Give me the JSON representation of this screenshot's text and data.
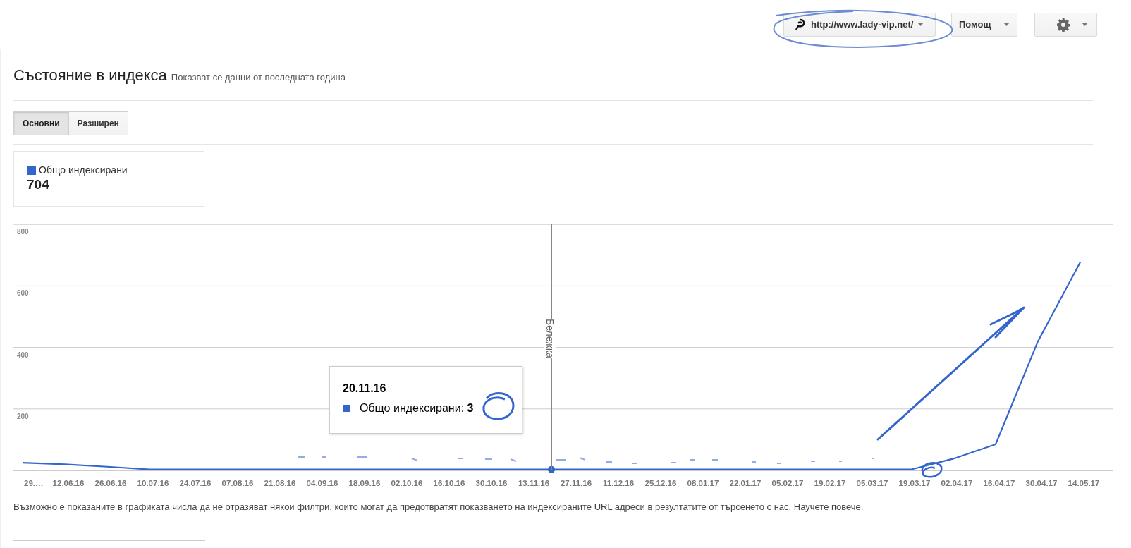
{
  "header": {
    "site_selector": {
      "label": "http://www.lady-vip.net/"
    },
    "help_menu": {
      "label": "Помощ"
    }
  },
  "page": {
    "title": "Състояние в индекса",
    "subtitle": "Показват се данни от последната година"
  },
  "tabs": [
    {
      "label": "Основни",
      "selected": true
    },
    {
      "label": "Разширен",
      "selected": false
    }
  ],
  "legend": {
    "label": "Общо индексирани",
    "value": "704"
  },
  "chart": {
    "chart_data": {
      "type": "line",
      "categories": [
        "29.…",
        "12.06.16",
        "26.06.16",
        "10.07.16",
        "24.07.16",
        "07.08.16",
        "21.08.16",
        "04.09.16",
        "18.09.16",
        "02.10.16",
        "16.10.16",
        "30.10.16",
        "13.11.16",
        "27.11.16",
        "11.12.16",
        "25.12.16",
        "08.01.17",
        "22.01.17",
        "05.02.17",
        "19.02.17",
        "05.03.17",
        "19.03.17",
        "02.04.17",
        "16.04.17",
        "30.04.17",
        "14.05.17"
      ],
      "series": [
        {
          "color": "#3366cc",
          "values": [
            25,
            20,
            12,
            3,
            3,
            3,
            3,
            3,
            3,
            3,
            3,
            3,
            3,
            3,
            3,
            3,
            3,
            3,
            3,
            3,
            3,
            3,
            38,
            85,
            420,
            677
          ]
        }
      ],
      "ylim": [
        0,
        800
      ],
      "yticks": [
        200,
        400,
        600,
        800
      ],
      "grid": true
    },
    "note": {
      "label": "Бележка"
    },
    "tooltip": {
      "date": "20.11.16",
      "text": "Общо индексирани: **3**"
    }
  },
  "footnote": "Възможно е показаните в графиката числа да не отразяват някои филтри, които могат да предотвратят показването на индексираните URL адреси в резултатите от търсенето с нас. Научете повече."
}
